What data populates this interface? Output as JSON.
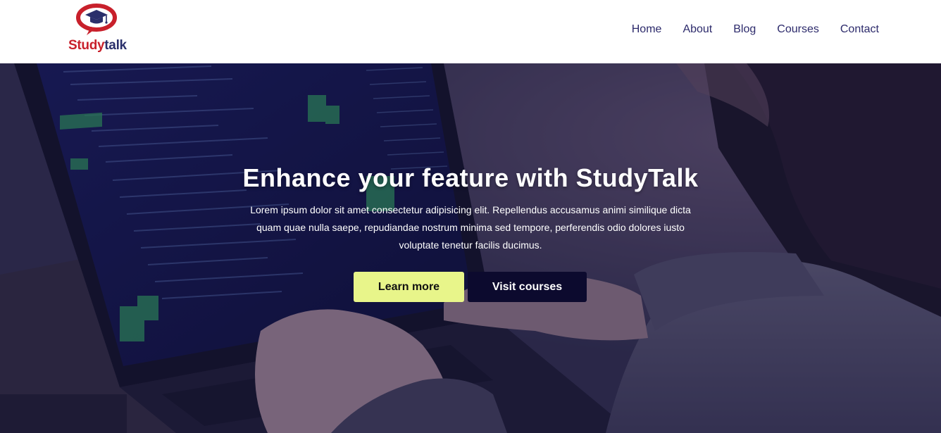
{
  "brand": {
    "name_part1": "Study",
    "name_part2": "talk",
    "logo_icon": "graduation-cap-speech-bubble-icon",
    "colors": {
      "red": "#c8202b",
      "navy": "#2a2f6b"
    }
  },
  "nav": {
    "items": [
      {
        "label": "Home"
      },
      {
        "label": "About"
      },
      {
        "label": "Blog"
      },
      {
        "label": "Courses"
      },
      {
        "label": "Contact"
      }
    ]
  },
  "hero": {
    "title": "Enhance your feature with StudyTalk",
    "description": "Lorem ipsum dolor sit amet consectetur adipisicing elit. Repellendus accusamus animi similique dicta quam quae nulla saepe, repudiandae nostrum minima sed tempore, perferendis odio dolores iusto voluptate tenetur facilis ducimus.",
    "buttons": {
      "learn_more": "Learn more",
      "visit_courses": "Visit courses"
    },
    "colors": {
      "learn_bg": "#e8f58a",
      "visit_bg": "#0c0a2e"
    }
  }
}
